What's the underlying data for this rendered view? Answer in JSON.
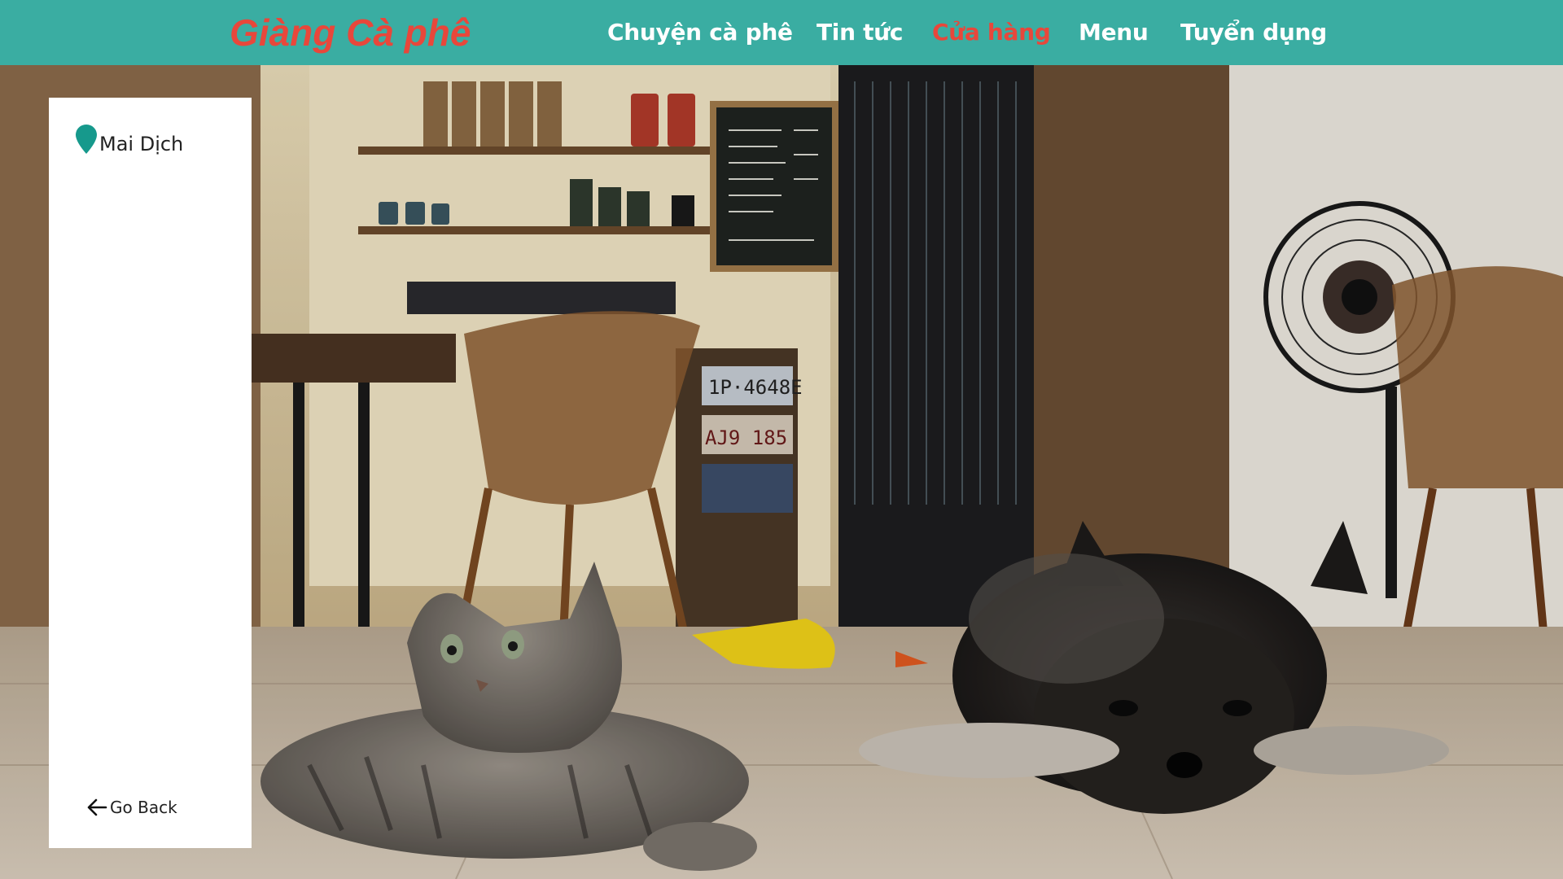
{
  "navbar": {
    "brand": "Giàng Cà phê",
    "links": [
      {
        "label": "Chuyện cà phê",
        "active": false
      },
      {
        "label": "Tin tức",
        "active": false
      },
      {
        "label": "Cửa hàng",
        "active": true
      },
      {
        "label": "Menu",
        "active": false
      },
      {
        "label": "Tuyển dụng",
        "active": false
      }
    ],
    "colors": {
      "background": "#3aada2",
      "text": "#ffffff",
      "accent": "#e8473b"
    }
  },
  "side_panel": {
    "location": {
      "icon": "map-pin-icon",
      "label": "Mai Dịch",
      "icon_color": "#16998c"
    },
    "go_back": {
      "icon": "arrow-left-icon",
      "label": "Go Back"
    }
  },
  "background_image": {
    "subject": "cat and dog lying on cafe floor"
  }
}
